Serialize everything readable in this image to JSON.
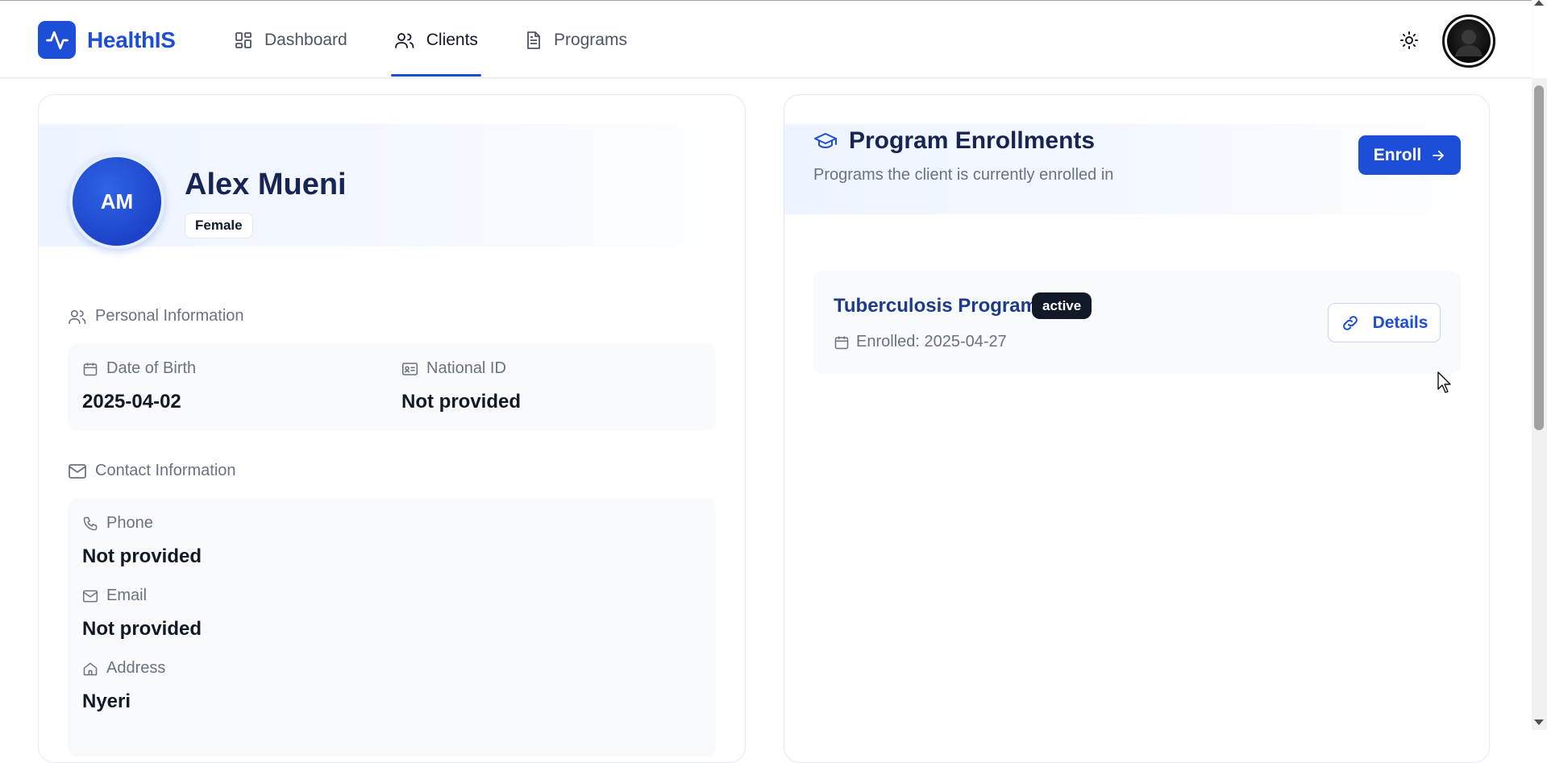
{
  "app": {
    "brand_name": "HealthIS",
    "brand_color": "#1d4ed8"
  },
  "nav": {
    "items": [
      {
        "label": "Dashboard",
        "icon": "dashboard-grid-icon",
        "active": false
      },
      {
        "label": "Clients",
        "icon": "users-icon",
        "active": true
      },
      {
        "label": "Programs",
        "icon": "document-icon",
        "active": false
      }
    ]
  },
  "header": {
    "theme_toggle_icon": "sun-icon"
  },
  "client": {
    "initials": "AM",
    "name": "Alex Mueni",
    "gender": "Female"
  },
  "personal_info": {
    "title": "Personal Information",
    "dob_label": "Date of Birth",
    "dob_value": "2025-04-02",
    "national_id_label": "National ID",
    "national_id_value": "Not provided"
  },
  "contact_info": {
    "title": "Contact Information",
    "phone_label": "Phone",
    "phone_value": "Not provided",
    "email_label": "Email",
    "email_value": "Not provided",
    "address_label": "Address",
    "address_value": "Nyeri"
  },
  "enrollments": {
    "title": "Program Enrollments",
    "subtitle": "Programs the client is currently enrolled in",
    "enroll_button": "Enroll",
    "items": [
      {
        "program": "Tuberculosis Program",
        "status": "active",
        "enrolled": "Enrolled: 2025-04-27",
        "details_button": "Details"
      }
    ]
  }
}
